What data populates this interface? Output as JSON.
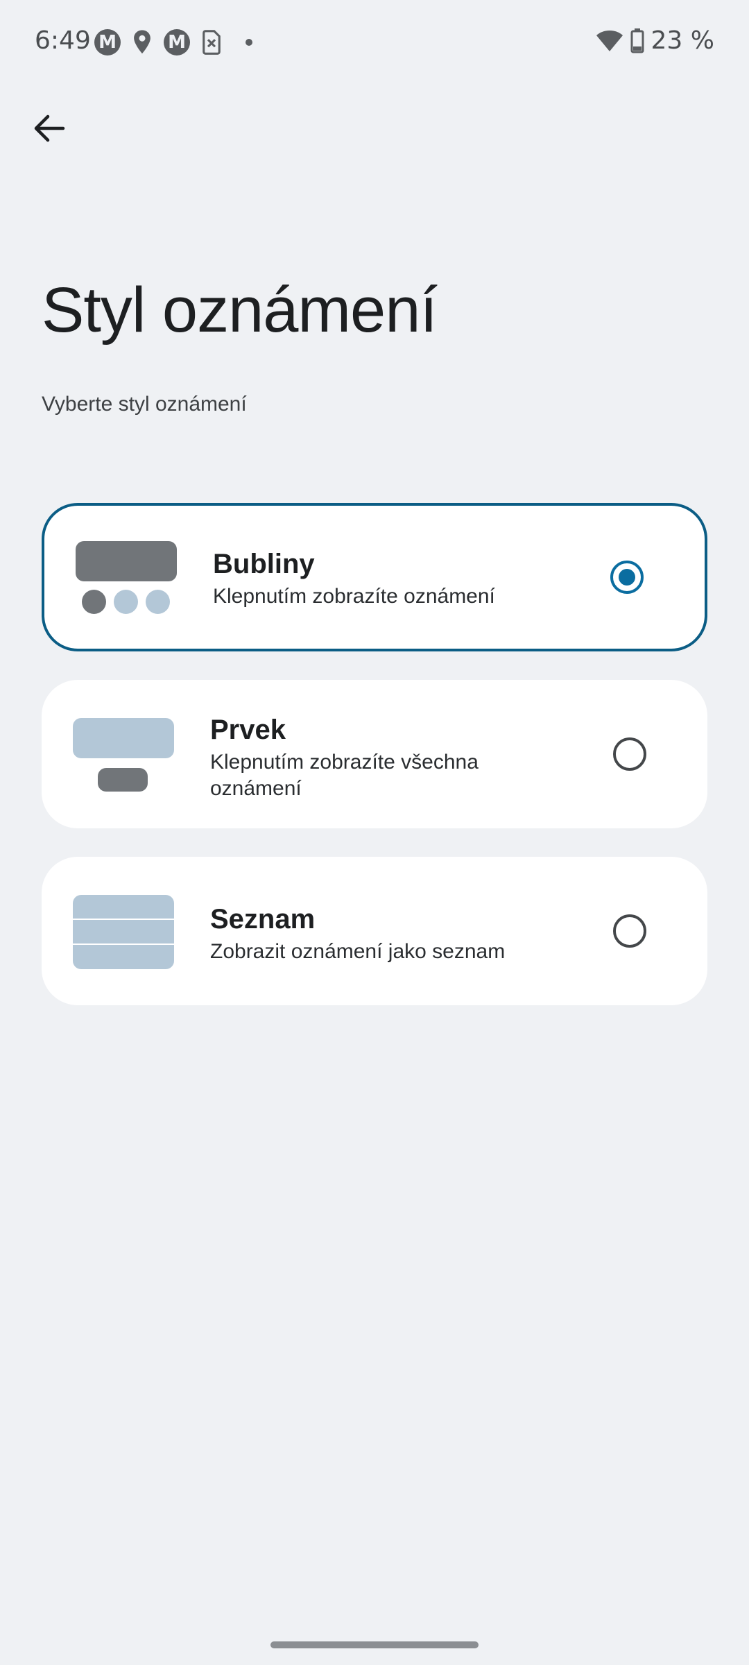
{
  "status_bar": {
    "time": "6:49",
    "battery": "23 %",
    "icons_left": [
      "motorola-icon",
      "location-icon",
      "motorola-icon",
      "sim-off-icon",
      "dot-icon"
    ],
    "icons_right": [
      "wifi-icon",
      "battery-icon"
    ],
    "moto_glyph": "M"
  },
  "header": {
    "back_icon": "arrow-left-icon",
    "title": "Styl oznámení",
    "subtitle": "Vyberte styl oznámení"
  },
  "options": [
    {
      "id": "bubbles",
      "title": "Bubliny",
      "description": "Klepnutím zobrazíte oznámení",
      "selected": true
    },
    {
      "id": "element",
      "title": "Prvek",
      "description": "Klepnutím zobrazíte všechna oznámení",
      "selected": false
    },
    {
      "id": "list",
      "title": "Seznam",
      "description": "Zobrazit oznámení jako seznam",
      "selected": false
    }
  ],
  "colors": {
    "background": "#eff1f4",
    "card": "#ffffff",
    "accent": "#0b6da0",
    "selected_border": "#0b5d85",
    "illustration_dark": "#717579",
    "illustration_light": "#b3c7d7"
  }
}
